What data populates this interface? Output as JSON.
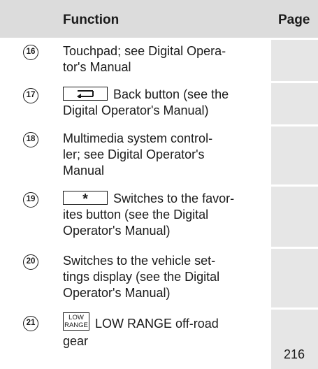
{
  "header": {
    "function_label": "Function",
    "page_label": "Page"
  },
  "rows": [
    {
      "num": "16",
      "lines": [
        "Touchpad; see Digital Opera-",
        "tor's Manual"
      ],
      "page": ""
    },
    {
      "num": "17",
      "key": "back-arrow-key",
      "lines": [
        "Back button (see the",
        "Digital Operator's Manual)"
      ],
      "page": ""
    },
    {
      "num": "18",
      "lines": [
        "Multimedia system control-",
        "ler; see Digital Operator's",
        "Manual"
      ],
      "page": ""
    },
    {
      "num": "19",
      "key": "star-key",
      "key_text": "*",
      "lines": [
        "Switches to the favor-",
        "ites button (see the Digital",
        "Operator's Manual)"
      ],
      "page": ""
    },
    {
      "num": "20",
      "lines": [
        "Switches to the vehicle set-",
        "tings display (see the Digital",
        "Operator's Manual)"
      ],
      "page": ""
    },
    {
      "num": "21",
      "key": "low-range-key",
      "key_text": [
        "LOW",
        "RANGE"
      ],
      "lines": [
        "LOW RANGE off-road",
        "gear"
      ],
      "page": "216"
    }
  ]
}
